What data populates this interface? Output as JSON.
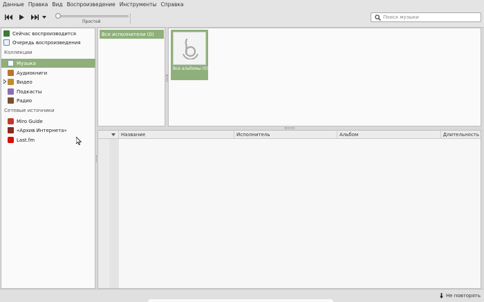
{
  "menu": [
    "Данные",
    "Правка",
    "Вид",
    "Воспроизведение",
    "Инструменты",
    "Справка"
  ],
  "player": {
    "status": "Простой",
    "seek_position": 0
  },
  "search": {
    "placeholder": "Поиск музыки",
    "value": ""
  },
  "sidebar": {
    "now_playing": "Сейчас воспроизводится",
    "play_queue": "Очередь воспроизведения",
    "collections_header": "Коллекции",
    "collections": [
      "Музыка",
      "Аудиокниги",
      "Видео",
      "Подкасты",
      "Радио"
    ],
    "selected": "Музыка",
    "online_header": "Сетевые источники",
    "online": [
      "Miro Guide",
      "«Архив Интернета»",
      "Last.fm"
    ]
  },
  "browser": {
    "all_artists": "Все исполнители (0)",
    "all_albums": "Все альбомы (0)"
  },
  "tracklist": {
    "columns": [
      "Название",
      "Исполнитель",
      "Альбом",
      "Длительность"
    ]
  },
  "status": {
    "repeat_label": "Не повторять"
  },
  "colors": {
    "selection": "#8fb07a",
    "background": "#fafafa",
    "chrome": "#e4e4e4"
  }
}
